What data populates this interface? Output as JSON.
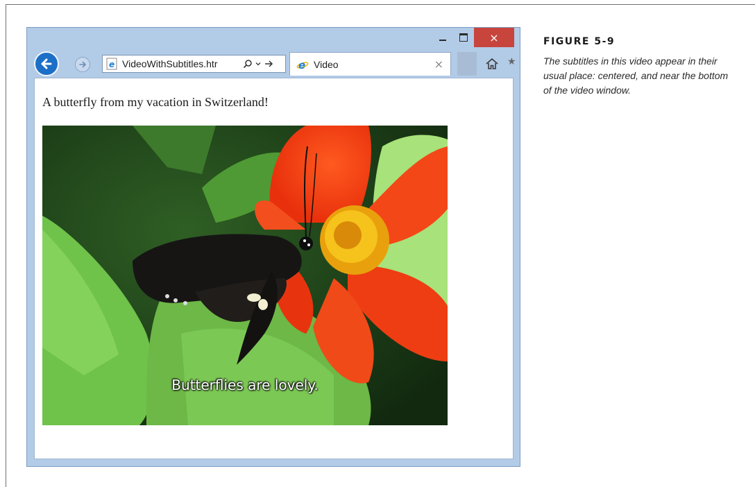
{
  "browser": {
    "address_text": "VideoWithSubtitles.htr",
    "tab_label": "Video",
    "close_symbol": "×",
    "accent_color": "#1c6fc7",
    "close_color": "#c7453d",
    "icons": [
      "back-icon",
      "forward-icon",
      "ie-page-icon",
      "search-icon",
      "dropdown-icon",
      "go-icon",
      "ie-tab-icon",
      "home-icon",
      "close-icon",
      "minimize-icon",
      "maximize-icon"
    ]
  },
  "page": {
    "intro_text": "A butterfly from my vacation in Switzerland!",
    "subtitle": "Butterflies are lovely."
  },
  "caption": {
    "label": "FIGURE 5-9",
    "text": "The subtitles in this video appear in their usual place: centered, and near the bottom of the video window."
  }
}
